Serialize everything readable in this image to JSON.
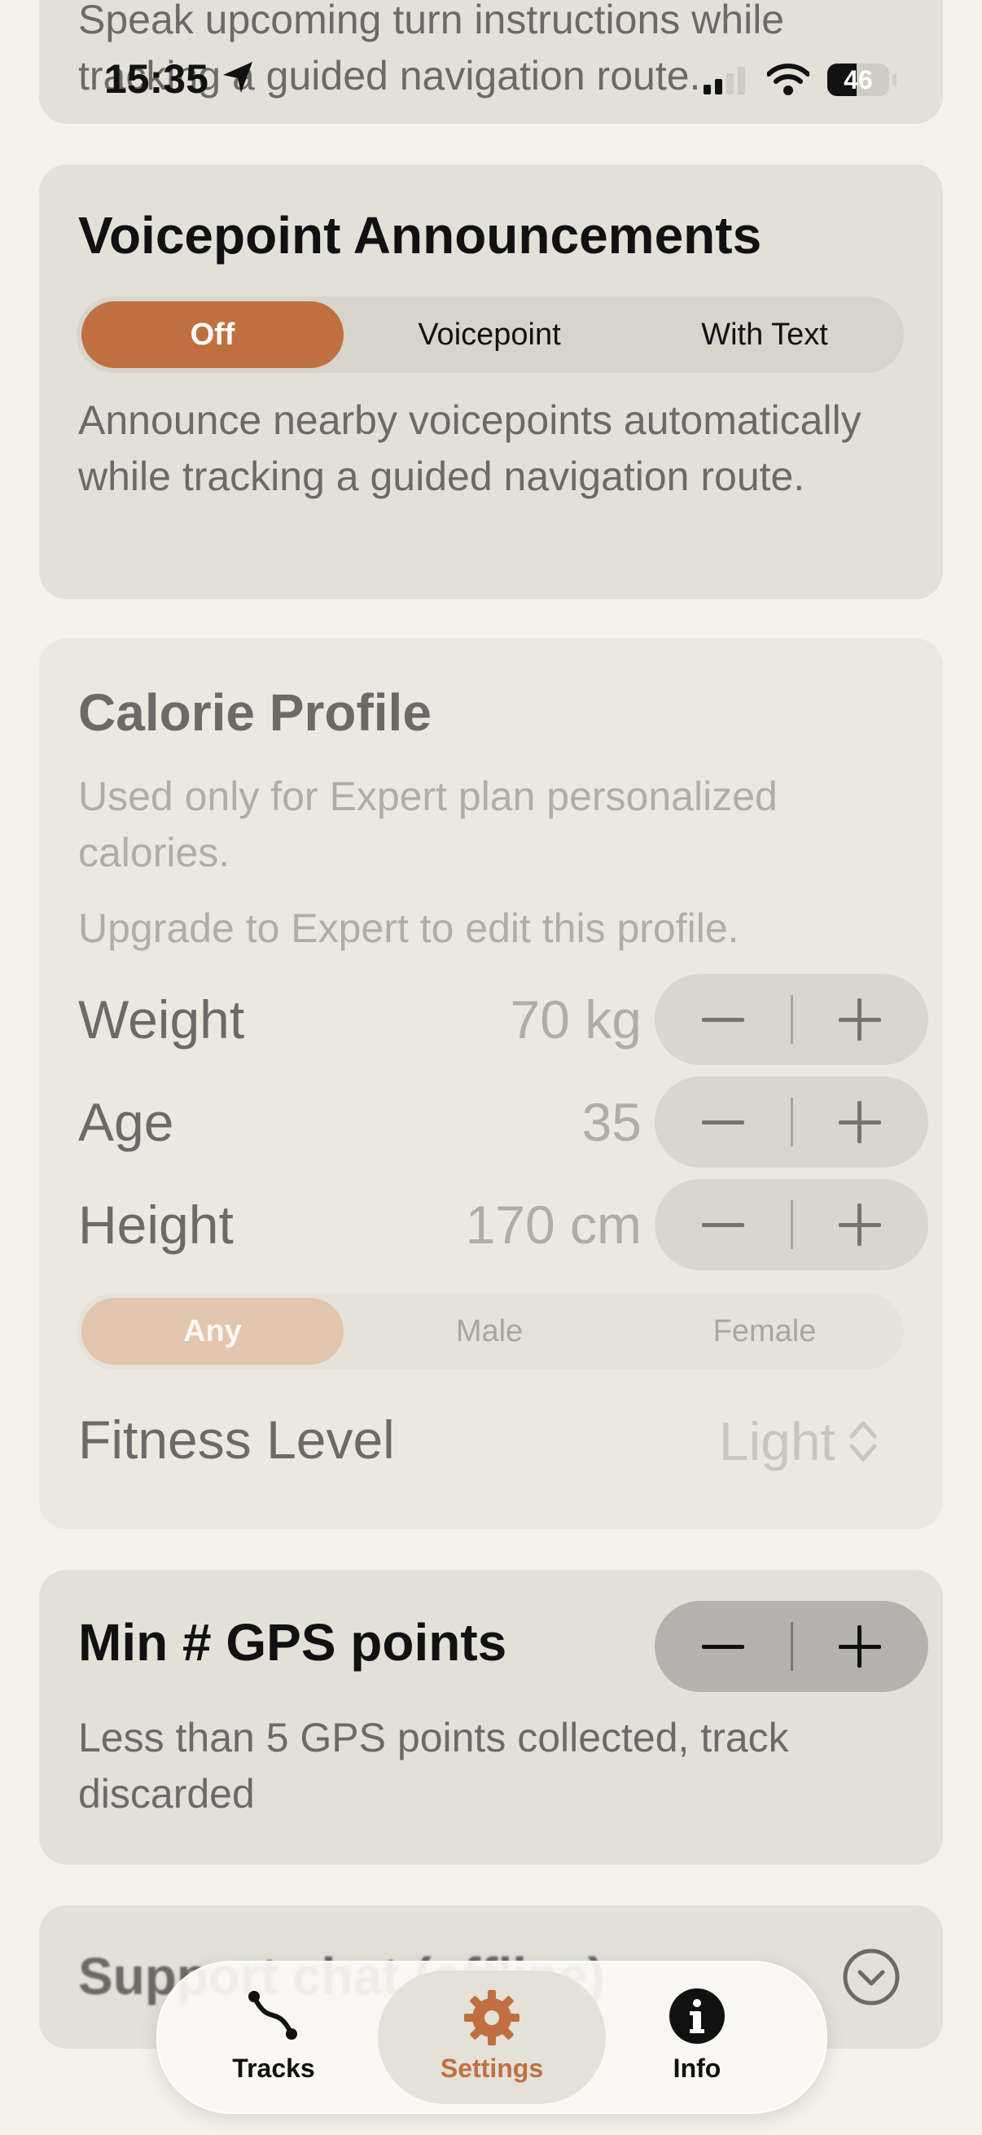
{
  "status_bar": {
    "time": "15:35",
    "battery": "46"
  },
  "turn_card": {
    "desc_partial": "Speak upcoming turn instructions while tracking a guided navigation route."
  },
  "voicepoint": {
    "title": "Voicepoint Announcements",
    "options": [
      "Off",
      "Voicepoint",
      "With Text"
    ],
    "selected": "Off",
    "description": "Announce nearby voicepoints automatically while tracking a guided navigation route."
  },
  "calorie": {
    "title": "Calorie Profile",
    "subtitle": "Used only for Expert plan personalized calories.",
    "upgrade_note": "Upgrade to Expert to edit this profile.",
    "weight": {
      "label": "Weight",
      "value": "70 kg"
    },
    "age": {
      "label": "Age",
      "value": "35"
    },
    "height": {
      "label": "Height",
      "value": "170 cm"
    },
    "sex_options": [
      "Any",
      "Male",
      "Female"
    ],
    "sex_selected": "Any",
    "fitness": {
      "label": "Fitness Level",
      "value": "Light"
    }
  },
  "gps": {
    "title": "Min # GPS points",
    "description": "Less than 5 GPS points collected, track discarded"
  },
  "support": {
    "title_partial": "Support chat (offline)"
  },
  "tabbar": {
    "tabs": [
      {
        "label": "Tracks",
        "icon": "route-icon"
      },
      {
        "label": "Settings",
        "icon": "gear-icon"
      },
      {
        "label": "Info",
        "icon": "info-icon"
      }
    ],
    "active": "Settings",
    "accent": "#c07040"
  }
}
